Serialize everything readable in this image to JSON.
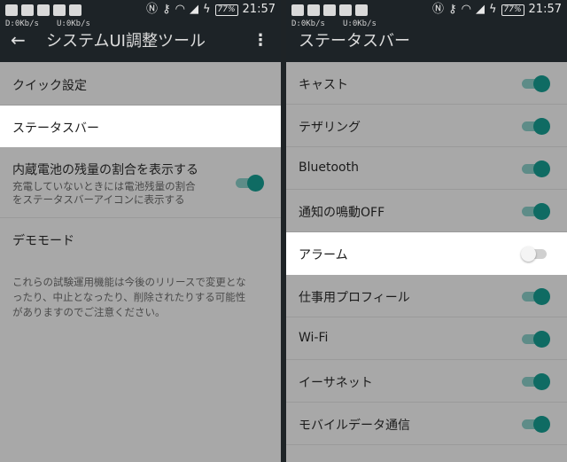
{
  "status_bar": {
    "battery": "77%",
    "time": "21:57",
    "download_speed": "D:0Kb/s",
    "upload_speed": "U:0Kb/s"
  },
  "left_screen": {
    "title": "システムUI調整ツール",
    "items": [
      {
        "label": "クイック設定"
      },
      {
        "label": "ステータスバー"
      },
      {
        "label": "内蔵電池の残量の割合を表示する",
        "subtitle_line1": "充電していないときには電池残量の割合",
        "subtitle_line2": "をステータスバーアイコンに表示する",
        "toggle": "on"
      },
      {
        "label": "デモモード"
      }
    ],
    "note_line1": "これらの試験運用機能は今後のリリースで変更とな",
    "note_line2": "ったり、中止となったり、削除されたりする可能性",
    "note_line3": "がありますのでご注意ください。"
  },
  "right_screen": {
    "title": "ステータスバー",
    "items": [
      {
        "label": "キャスト",
        "toggle": "on"
      },
      {
        "label": "テザリング",
        "toggle": "on"
      },
      {
        "label": "Bluetooth",
        "toggle": "on"
      },
      {
        "label": "通知の鳴動OFF",
        "toggle": "on"
      },
      {
        "label": "アラーム",
        "toggle": "off"
      },
      {
        "label": "仕事用プロフィール",
        "toggle": "on"
      },
      {
        "label": "Wi-Fi",
        "toggle": "on"
      },
      {
        "label": "イーサネット",
        "toggle": "on"
      },
      {
        "label": "モバイルデータ通信",
        "toggle": "on"
      }
    ]
  },
  "colors": {
    "accent": "#0f6b63",
    "app_bar": "#1d2327",
    "list_background": "#a8a8a8",
    "highlight": "#ffffff"
  }
}
